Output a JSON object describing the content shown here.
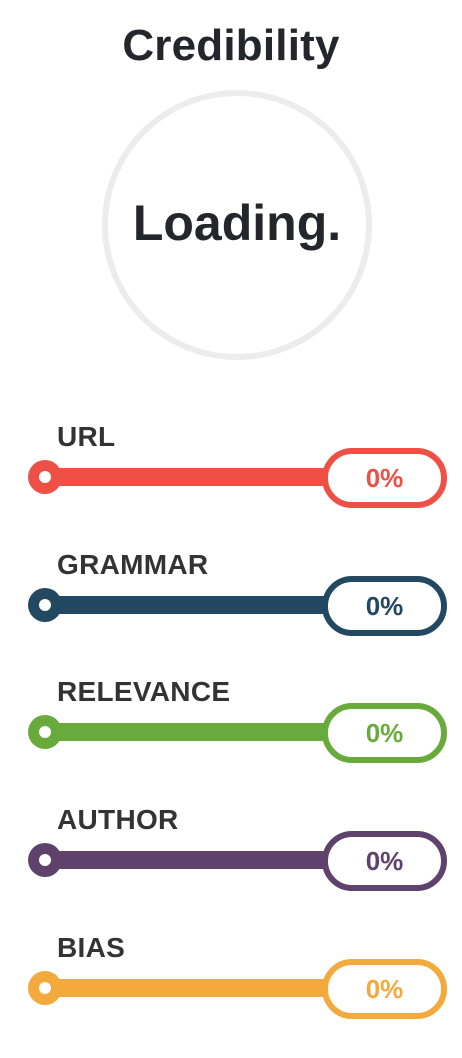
{
  "header": {
    "title": "Credibility"
  },
  "score": {
    "text": "Loading."
  },
  "metrics": [
    {
      "label": "URL",
      "value": "0%",
      "progress": 0,
      "color": "#ef5046"
    },
    {
      "label": "GRAMMAR",
      "value": "0%",
      "progress": 0,
      "color": "#234862"
    },
    {
      "label": "RELEVANCE",
      "value": "0%",
      "progress": 0,
      "color": "#68aa3c"
    },
    {
      "label": "AUTHOR",
      "value": "0%",
      "progress": 0,
      "color": "#5e426b"
    },
    {
      "label": "BIAS",
      "value": "0%",
      "progress": 0,
      "color": "#f3a93b"
    }
  ]
}
